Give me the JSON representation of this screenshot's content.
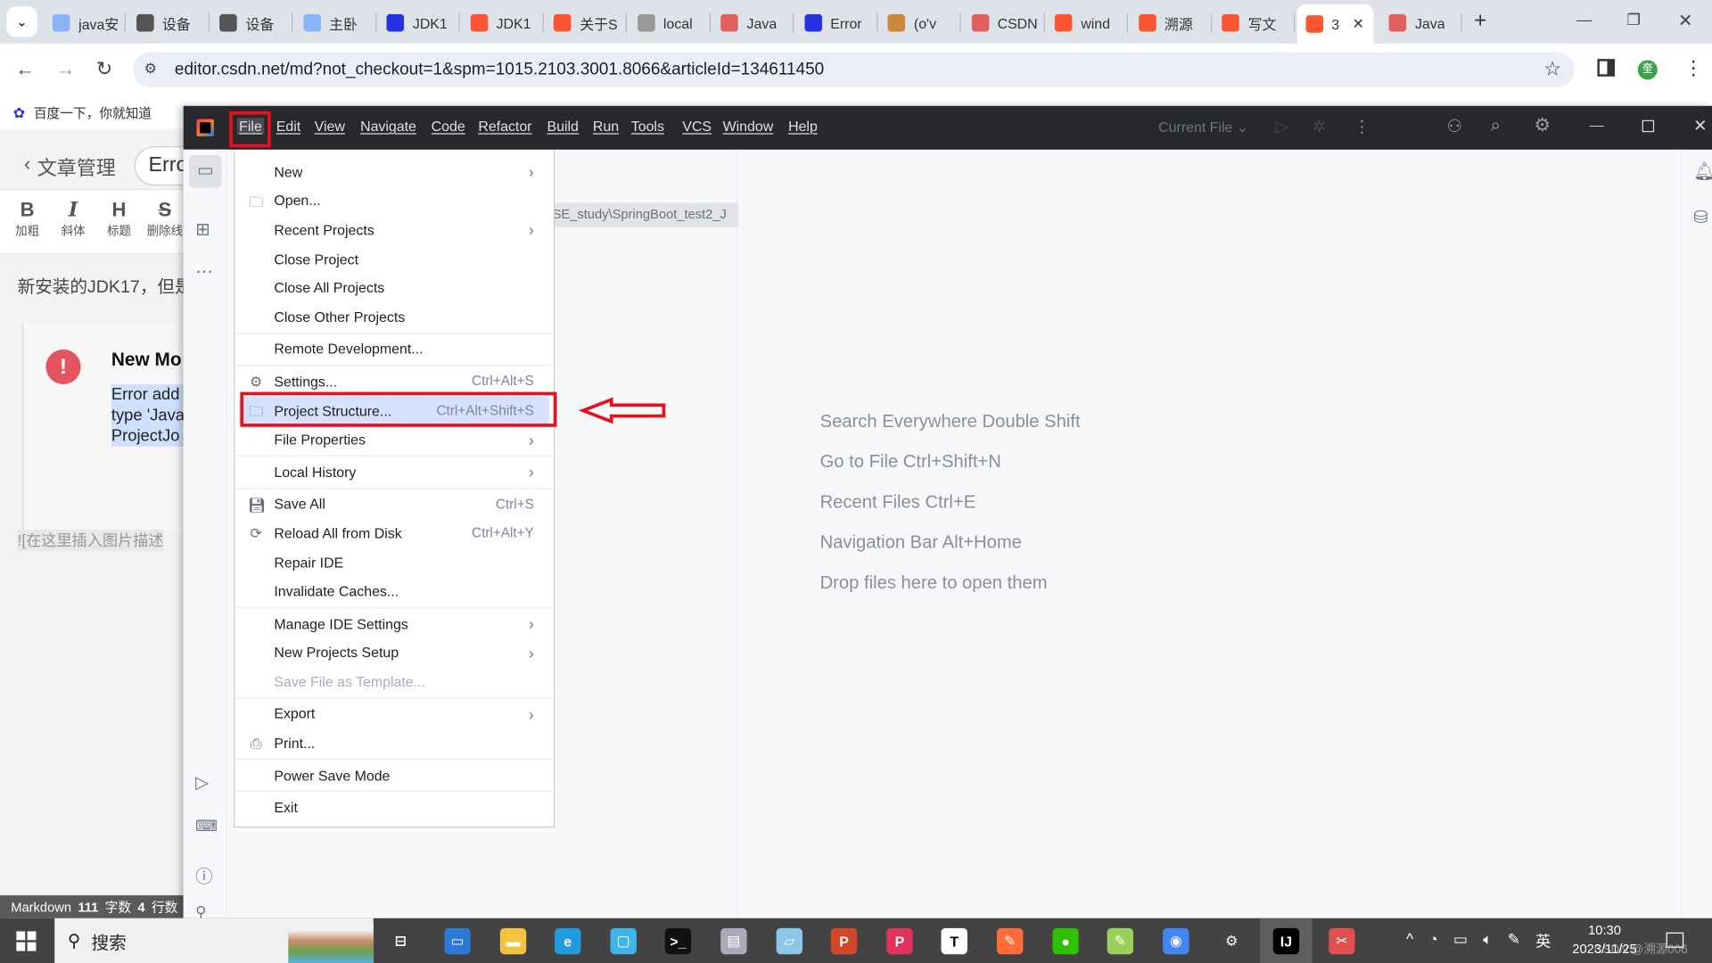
{
  "browser": {
    "tabs": [
      {
        "title": "java安",
        "color": "#8ab4f8"
      },
      {
        "title": "设备",
        "color": "#555"
      },
      {
        "title": "设备",
        "color": "#555"
      },
      {
        "title": "主卧",
        "color": "#8ab4f8"
      },
      {
        "title": "JDK1",
        "color": "#2932e1"
      },
      {
        "title": "JDK1",
        "color": "#fc5531"
      },
      {
        "title": "关于S",
        "color": "#fc5531"
      },
      {
        "title": "local",
        "color": "#999"
      },
      {
        "title": "Java",
        "color": "#e06060"
      },
      {
        "title": "Error",
        "color": "#2932e1"
      },
      {
        "title": "(o'v",
        "color": "#c98a3a"
      },
      {
        "title": "CSDN",
        "color": "#e06060"
      },
      {
        "title": "wind",
        "color": "#fc5531"
      },
      {
        "title": "溯源",
        "color": "#fc5531"
      },
      {
        "title": "写文",
        "color": "#fc5531"
      },
      {
        "title": "3",
        "color": "#fc5531",
        "active": true
      },
      {
        "title": "Java",
        "color": "#e06060"
      }
    ],
    "new_tab": "+",
    "url": "editor.csdn.net/md?not_checkout=1&spm=1015.2103.3001.8066&articleId=134611450",
    "bookmark": "百度一下，你就知道",
    "profile_initial": "奎"
  },
  "csdn": {
    "back_label": "文章管理",
    "title_input": "Erro",
    "toolbar": [
      {
        "glyph": "B",
        "label": "加粗"
      },
      {
        "glyph": "I",
        "label": "斜体"
      },
      {
        "glyph": "H",
        "label": "标题"
      },
      {
        "glyph": "S",
        "label": "删除线"
      }
    ],
    "body_text": "新安装的JDK17，但是",
    "notice_title": "New Mo",
    "notice_lines": [
      "Error add",
      "type 'Java",
      "ProjectJo"
    ],
    "image_placeholder": "![在这里插入图片描述",
    "status": {
      "mode": "Markdown",
      "chars": "111",
      "chars_label": "字数",
      "lines": "4",
      "lines_label": "行数"
    }
  },
  "ide": {
    "menubar": [
      "File",
      "Edit",
      "View",
      "Navigate",
      "Code",
      "Refactor",
      "Build",
      "Run",
      "Tools",
      "VCS",
      "Window",
      "Help"
    ],
    "run_config": "Current File",
    "project_path": "SE_study\\SpringBoot_test2_J",
    "welcome": [
      "Search Everywhere Double Shift",
      "Go to File Ctrl+Shift+N",
      "Recent Files Ctrl+E",
      "Navigation Bar Alt+Home",
      "Drop files here to open them"
    ],
    "file_menu": [
      {
        "label": "New",
        "submenu": true
      },
      {
        "label": "Open...",
        "icon": "folder"
      },
      {
        "label": "Recent Projects",
        "submenu": true
      },
      {
        "label": "Close Project"
      },
      {
        "label": "Close All Projects"
      },
      {
        "label": "Close Other Projects",
        "sep_after": true
      },
      {
        "label": "Remote Development...",
        "sep_after": true
      },
      {
        "label": "Settings...",
        "icon": "gear",
        "shortcut": "Ctrl+Alt+S"
      },
      {
        "label": "Project Structure...",
        "icon": "project-structure",
        "shortcut": "Ctrl+Alt+Shift+S",
        "selected": true
      },
      {
        "label": "File Properties",
        "submenu": true,
        "sep_after": true
      },
      {
        "label": "Local History",
        "submenu": true,
        "sep_after": true
      },
      {
        "label": "Save All",
        "icon": "save",
        "shortcut": "Ctrl+S"
      },
      {
        "label": "Reload All from Disk",
        "icon": "reload",
        "shortcut": "Ctrl+Alt+Y"
      },
      {
        "label": "Repair IDE"
      },
      {
        "label": "Invalidate Caches...",
        "sep_after": true
      },
      {
        "label": "Manage IDE Settings",
        "submenu": true
      },
      {
        "label": "New Projects Setup",
        "submenu": true
      },
      {
        "label": "Save File as Template...",
        "disabled": true,
        "sep_after": true
      },
      {
        "label": "Export",
        "submenu": true
      },
      {
        "label": "Print...",
        "icon": "print",
        "sep_after": true
      },
      {
        "label": "Power Save Mode",
        "sep_after": true
      },
      {
        "label": "Exit"
      }
    ]
  },
  "annotation_color": "#e8101c",
  "taskbar": {
    "search": "搜索",
    "apps": [
      {
        "name": "task-view",
        "color": "transparent",
        "glyph": "⊟"
      },
      {
        "name": "remote-desktop",
        "color": "#2b7bd6",
        "glyph": "▭"
      },
      {
        "name": "file-explorer",
        "color": "#f5c242",
        "glyph": "▬"
      },
      {
        "name": "edge",
        "color": "#1f9be0",
        "glyph": "e"
      },
      {
        "name": "bilibili",
        "color": "#3fb4e8",
        "glyph": "▢"
      },
      {
        "name": "terminal",
        "color": "#111",
        "glyph": ">_"
      },
      {
        "name": "resource-monitor",
        "color": "#aab",
        "glyph": "▤"
      },
      {
        "name": "notepad",
        "color": "#8cc6e8",
        "glyph": "▱"
      },
      {
        "name": "powerpoint",
        "color": "#d24726",
        "glyph": "P"
      },
      {
        "name": "wps-pdf",
        "color": "#e0325a",
        "glyph": "P"
      },
      {
        "name": "typora",
        "color": "#fff",
        "glyph": "T"
      },
      {
        "name": "postman",
        "color": "#ff6c37",
        "glyph": "✎"
      },
      {
        "name": "wechat",
        "color": "#2dc100",
        "glyph": "●"
      },
      {
        "name": "notepad-plus",
        "color": "#9bcf5b",
        "glyph": "✎"
      },
      {
        "name": "chrome",
        "color": "#4285f4",
        "glyph": "◉"
      },
      {
        "name": "settings",
        "color": "transparent",
        "glyph": "⚙"
      },
      {
        "name": "intellij-idea",
        "color": "#000",
        "glyph": "IJ",
        "active": true
      },
      {
        "name": "snipping-tool",
        "color": "#e05050",
        "glyph": "✂"
      }
    ],
    "tray": {
      "ime": "英",
      "time": "10:30",
      "date": "2023/11/25"
    },
    "watermark": "CSDN @溯源006"
  }
}
